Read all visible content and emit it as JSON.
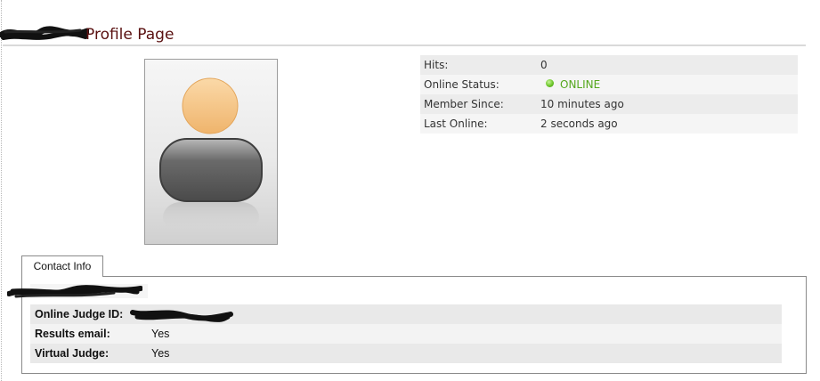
{
  "page": {
    "title": "Profile Page"
  },
  "avatar": {
    "icon": "default-user-avatar-icon",
    "head_color": "#f5c386",
    "body_color": "#5d5d5d"
  },
  "stats": {
    "rows": [
      {
        "key": "Hits:",
        "value": "0"
      },
      {
        "key": "Online Status:",
        "value": "ONLINE",
        "icon": "online-dot-icon",
        "color": "#55a71e"
      },
      {
        "key": "Member Since:",
        "value": "10 minutes ago"
      },
      {
        "key": "Last Online:",
        "value": "2 seconds ago"
      }
    ]
  },
  "tabs": [
    {
      "label": "Contact Info",
      "active": true
    }
  ],
  "contact": {
    "rows": [
      {
        "key": "Online Judge ID:",
        "value": ""
      },
      {
        "key": "Results email:",
        "value": "Yes"
      },
      {
        "key": "Virtual Judge:",
        "value": "Yes"
      }
    ]
  }
}
